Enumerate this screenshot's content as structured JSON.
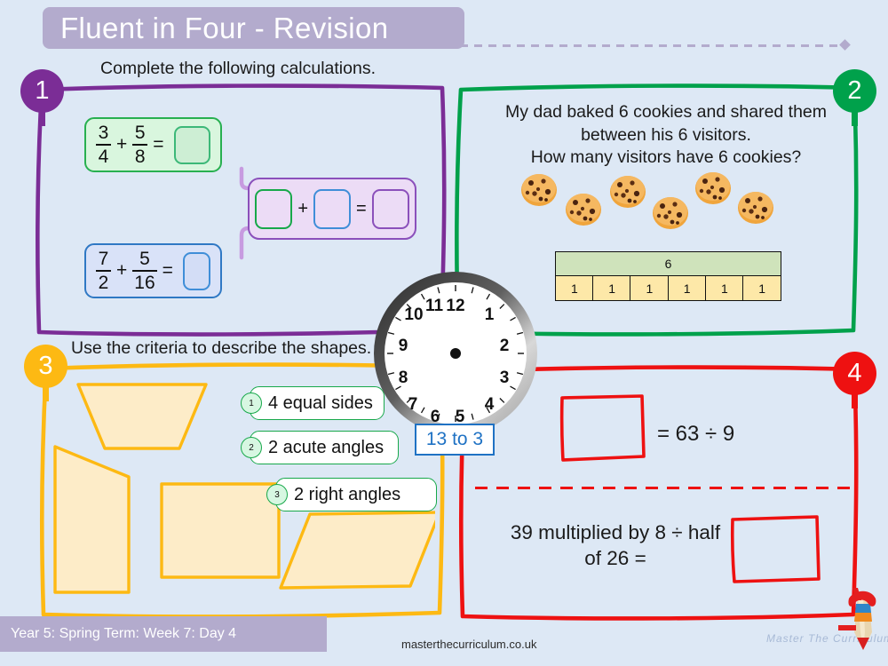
{
  "page": {
    "background_color": "#dde8f5",
    "title": "Fluent in Four - Revision"
  },
  "panels": [
    {
      "number": "1",
      "badge_color": "#7b2d96",
      "heading": "Complete the following calculations.",
      "border_color": "#7b2d96"
    },
    {
      "number": "2",
      "badge_color": "#00a14b",
      "border_color": "#00a14b"
    },
    {
      "number": "3",
      "badge_color": "#fdb913",
      "heading": "Use the criteria to describe the shapes.",
      "border_color": "#fdb913"
    },
    {
      "number": "4",
      "badge_color": "#ee1111",
      "border_color": "#ee1111"
    }
  ],
  "panel1": {
    "calc_1": {
      "frac_a_num": "3",
      "frac_a_den": "4",
      "plus": "+",
      "frac_b_num": "5",
      "frac_b_den": "8",
      "equals": "=",
      "answer": "",
      "fill_color": "#d9f6de",
      "border_color": "#28b050"
    },
    "calc_2": {
      "frac_a_num": "7",
      "frac_a_den": "2",
      "plus": "+",
      "frac_b_num": "5",
      "frac_b_den": "16",
      "equals": "=",
      "answer": "",
      "fill_color": "#d9e2f8",
      "border_color": "#2f78c4"
    },
    "combination": {
      "cell_a": "",
      "cell_b": "",
      "cell_c": "",
      "plus": "+",
      "equals": "=",
      "fill_color": "#ecdcf6",
      "border_color": "#8b50bb"
    }
  },
  "panel2": {
    "question_line_1": "My dad baked 6 cookies and shared them",
    "question_line_2": "between his 6 visitors.",
    "question_line_3": "How many visitors have 6 cookies?",
    "cookie_count": 6,
    "bar_model": {
      "whole_label": "6",
      "whole_fill": "#cfe3bb",
      "part_labels": [
        "1",
        "1",
        "1",
        "1",
        "1",
        "1"
      ],
      "part_fill": "#fde8a8"
    }
  },
  "panel3": {
    "criteria": [
      {
        "number": "1",
        "label": "4 equal sides"
      },
      {
        "number": "2",
        "label": "2 acute angles"
      },
      {
        "number": "3",
        "label": "2 right angles"
      }
    ],
    "shapes": [
      {
        "name": "isosceles-trapezium"
      },
      {
        "name": "right-trapezium"
      },
      {
        "name": "square"
      },
      {
        "name": "parallelogram"
      }
    ],
    "shape_fill": "#fdecc8",
    "shape_stroke": "#fdb913"
  },
  "panel4": {
    "equation_1": "= 63 ÷ 9",
    "equation_1_answer": "",
    "equation_2_line_1": "39 multiplied by 8 ÷ half",
    "equation_2_line_2": "of 26 =",
    "equation_2_answer": "",
    "divider_color": "#ee1111"
  },
  "clock": {
    "numerals": [
      "12",
      "1",
      "2",
      "3",
      "4",
      "5",
      "6",
      "7",
      "8",
      "9",
      "10",
      "11"
    ],
    "label": "13 to 3",
    "label_color": "#1f72c4",
    "hands_shown": false
  },
  "footer": {
    "band_text": "Year 5: Spring Term: Week 7: Day 4",
    "url": "masterthecurriculum.co.uk",
    "wordmark": "Master The Curriculum"
  }
}
